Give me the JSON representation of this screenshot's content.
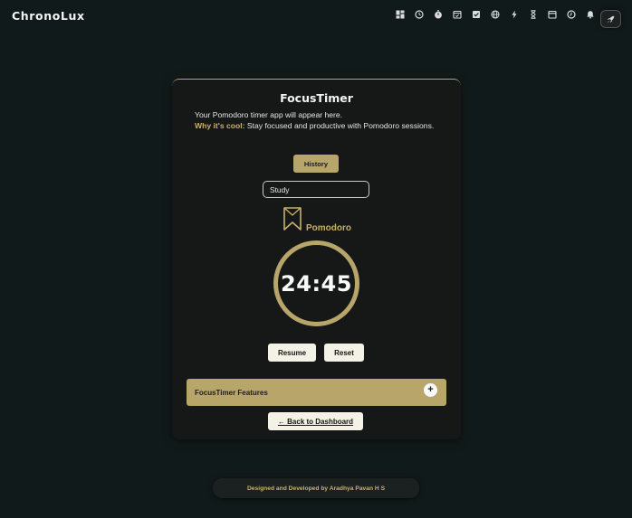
{
  "app": {
    "brand": "ChronoLux"
  },
  "nav": {
    "icons": [
      "dashboard-icon",
      "clock-icon",
      "stopwatch-icon",
      "calendar-check-icon",
      "checkbox-icon",
      "globe-icon",
      "bolt-icon",
      "hourglass-icon",
      "calendar-icon",
      "history-clock-icon",
      "bell-icon"
    ],
    "rocket_icon": "rocket-icon"
  },
  "card": {
    "title": "FocusTimer",
    "intro_line": "Your Pomodoro timer app will appear here.",
    "why_label": "Why it's cool:",
    "why_text": " Stay focused and productive with Pomodoro sessions."
  },
  "controls": {
    "history_label": "History",
    "task_value": "Study",
    "mode_icon": "bookmark-icon",
    "mode_label": "Pomodoro",
    "timer": "24:45",
    "resume_label": "Resume",
    "reset_label": "Reset"
  },
  "features": {
    "label": "FocusTimer Features",
    "toggle": "+"
  },
  "back_label": "← Back to Dashboard",
  "footer": {
    "text": "Designed and Developed by Aradhya Pavan H S"
  },
  "colors": {
    "accent": "#b7a56a",
    "accent_text": "#c9b06a",
    "background": "#111a1a",
    "card": "#161818"
  }
}
